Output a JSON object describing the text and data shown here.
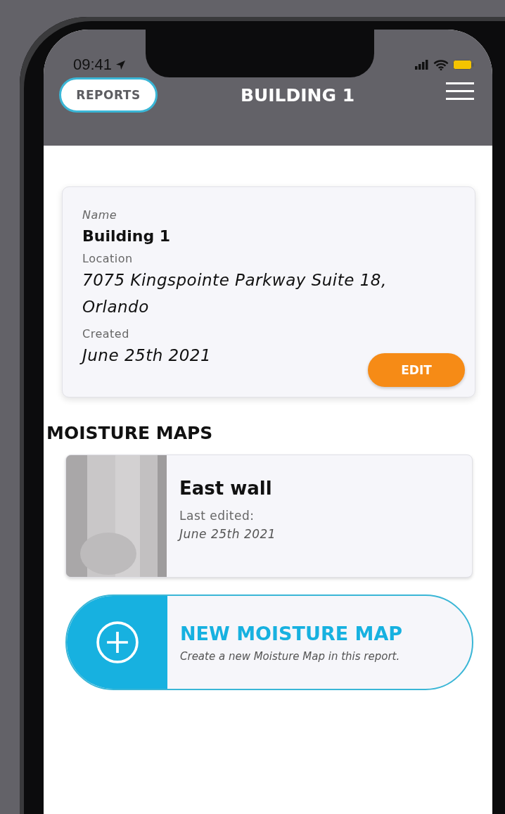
{
  "status_bar": {
    "time": "09:41"
  },
  "header": {
    "back_button": "REPORTS",
    "title": "BUILDING 1"
  },
  "building_card": {
    "fields": [
      {
        "label": "Name",
        "value": "Building 1",
        "kind": "bold"
      },
      {
        "label": "Location",
        "value": "7075 Kingspointe Parkway Suite 18, Orlando",
        "kind": "italic"
      },
      {
        "label": "Created",
        "value": "June 25th 2021",
        "kind": "italic"
      }
    ],
    "edit_button": "EDIT"
  },
  "section_title": "MOISTURE MAPS",
  "moisture_maps": [
    {
      "title": "East wall",
      "edited_label": "Last edited:",
      "edited_date": "June 25th 2021"
    }
  ],
  "new_map_button": {
    "title": "NEW MOISTURE MAP",
    "subtitle": "Create a new Moisture Map in this report."
  }
}
